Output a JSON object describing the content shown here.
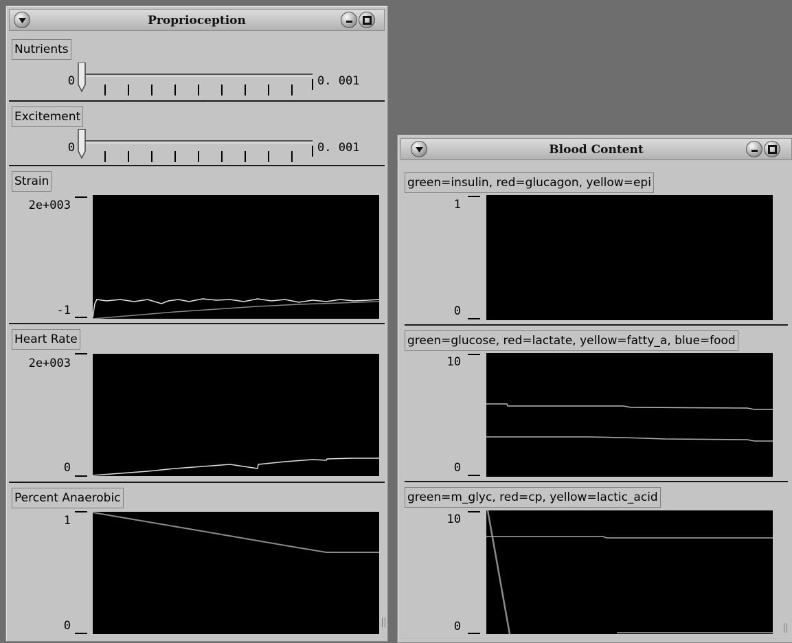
{
  "proprioception": {
    "title": "Proprioception",
    "sliders": [
      {
        "label": "Nutrients",
        "min": "0",
        "max": "0. 001",
        "value": 0
      },
      {
        "label": "Excitement",
        "min": "0",
        "max": "0. 001",
        "value": 0
      }
    ],
    "plots": [
      {
        "label": "Strain",
        "ymax": "2e+003",
        "ymin": "-1"
      },
      {
        "label": "Heart Rate",
        "ymax": "2e+003",
        "ymin": "0"
      },
      {
        "label": "Percent Anaerobic",
        "ymax": "1",
        "ymin": "0"
      }
    ]
  },
  "blood_content": {
    "title": "Blood Content",
    "plots": [
      {
        "label": "green=insulin, red=glucagon, yellow=epi",
        "ymax": "1",
        "ymin": "0"
      },
      {
        "label": "green=glucose, red=lactate, yellow=fatty_a, blue=food",
        "ymax": "10",
        "ymin": "0"
      },
      {
        "label": "green=m_glyc, red=cp, yellow=lactic_acid",
        "ymax": "10",
        "ymin": "0"
      }
    ]
  },
  "colors": {
    "desktop": "#6e6e6e",
    "window": "#c4c4c4",
    "plot_bg": "#000000",
    "trace_gray": "#8a8a8a",
    "trace_white": "#e8e8e8"
  },
  "icons": [
    "menu-arrow-icon",
    "minimize-icon",
    "maximize-icon"
  ]
}
